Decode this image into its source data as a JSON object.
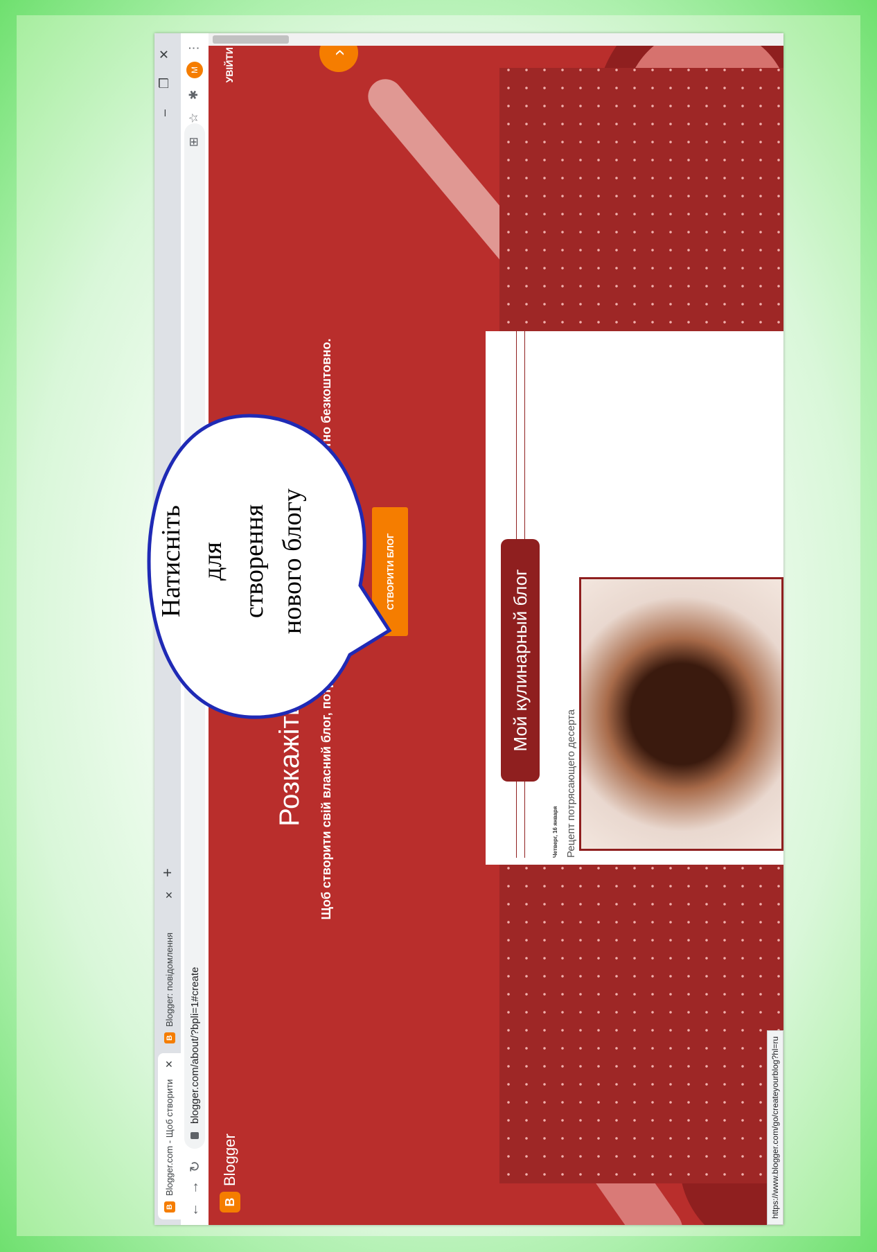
{
  "browser": {
    "tab_active": "Blogger.com - Щоб створити",
    "tab_inactive": "Blogger: повідомлення",
    "url": "blogger.com/about/?bpli=1#create",
    "avatar_letter": "M"
  },
  "page": {
    "logo_text": "Blogger",
    "signin": "УВІЙТИ",
    "headline": "Розкажіть про свої захоплення",
    "subline": "Щоб створити свій власний блог, потрібно лише кілька хвилин. І це абсолютно безкоштовно.",
    "cta": "СТВОРИТИ БЛОГ",
    "card": {
      "blog_title": "Мой кулинарный блог",
      "date": "Четверг, 16 января",
      "post_title": "Рецепт потрясающего десерта"
    },
    "status_url": "https://www.blogger.com/go/createyourblog?hl=ru"
  },
  "callout": {
    "line1": "Натисніть",
    "line2": "для",
    "line3": "створення",
    "line4": "нового блогу"
  },
  "colors": {
    "page_bg": "#b92e2c",
    "accent": "#f57d00",
    "frame": "#7ee27e"
  }
}
